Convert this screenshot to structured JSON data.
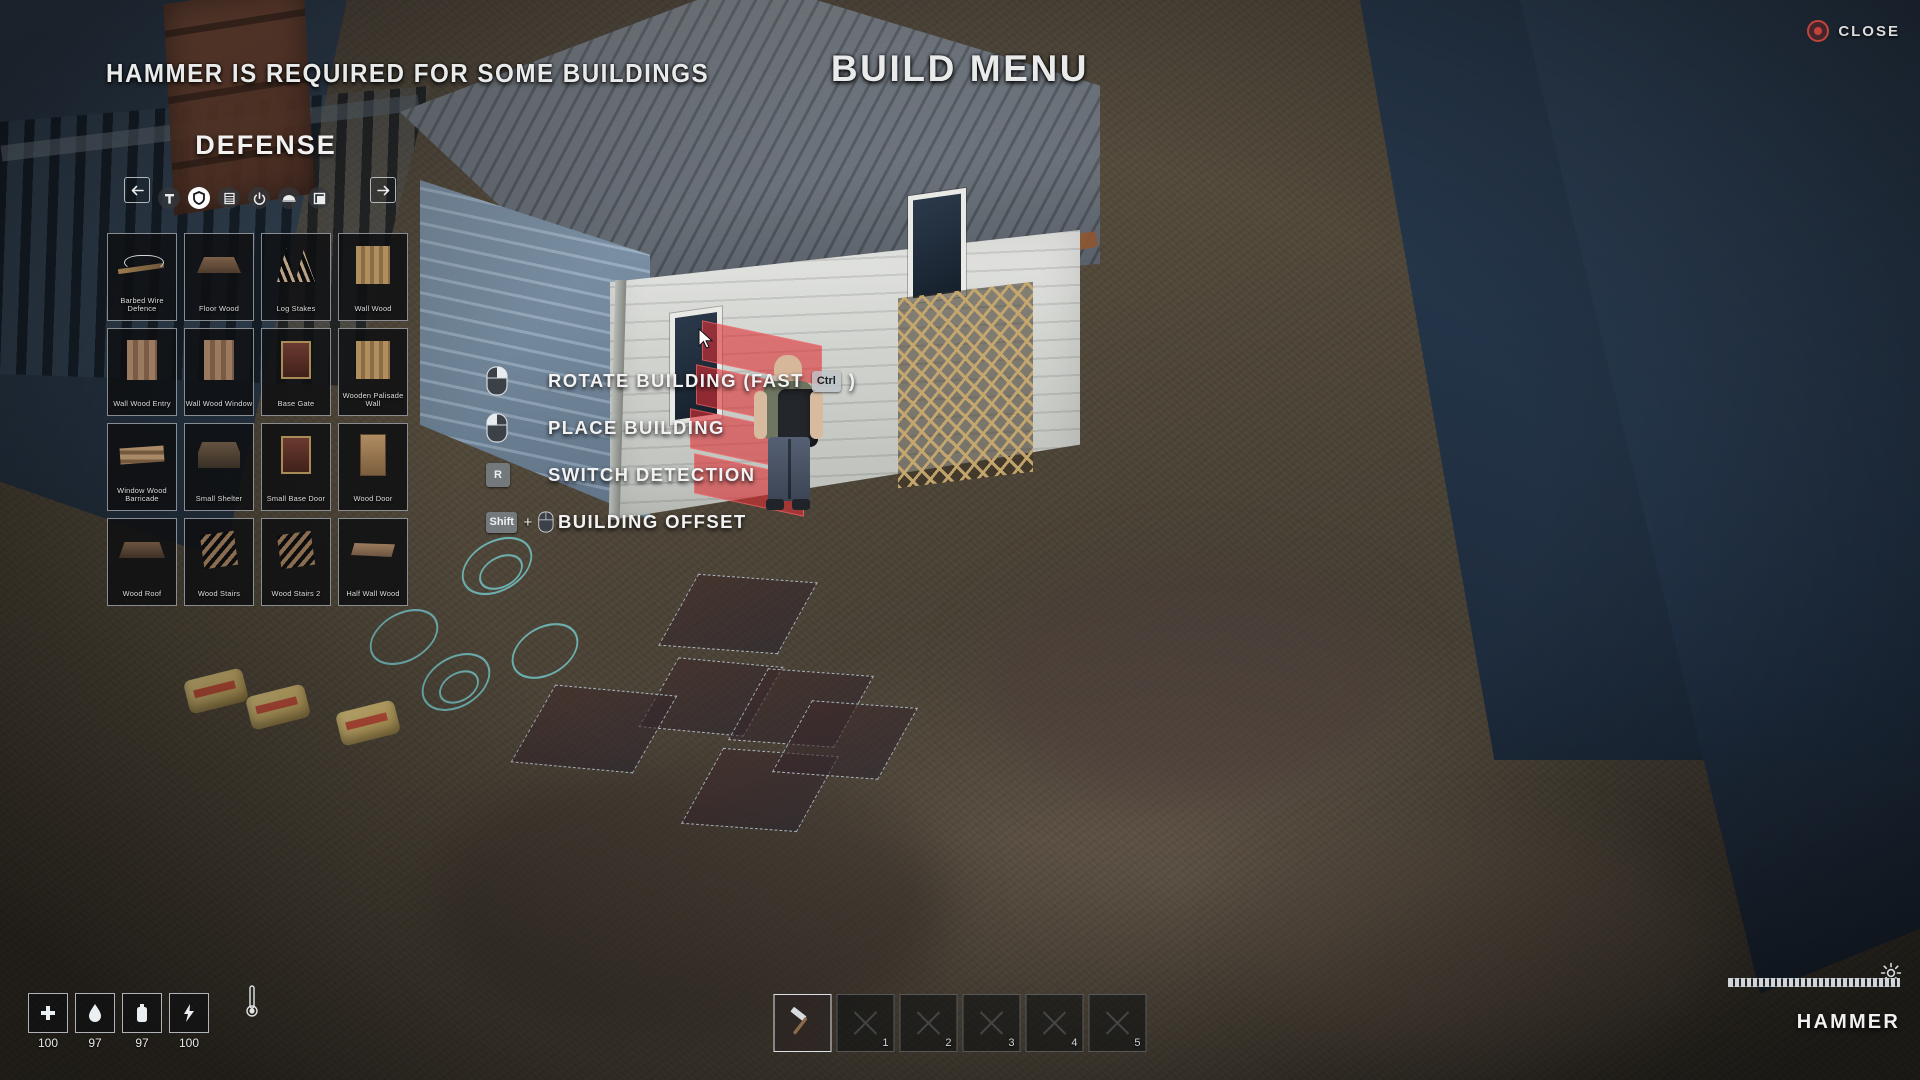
{
  "header": {
    "hint_top": "HAMMER IS REQUIRED FOR SOME BUILDINGS",
    "title": "BUILD MENU",
    "close_label": "CLOSE",
    "close_icon": "close-circle-icon"
  },
  "panel": {
    "category_title": "DEFENSE",
    "prev_arrow": "←",
    "next_arrow": "→",
    "prev_icon": "arrow-left-icon",
    "next_icon": "arrow-right-icon",
    "category_icons": [
      {
        "name": "hammer-icon",
        "label": "Tools",
        "active": false
      },
      {
        "name": "shield-icon",
        "label": "Defense",
        "active": true
      },
      {
        "name": "storage-icon",
        "label": "Storage",
        "active": false
      },
      {
        "name": "power-icon",
        "label": "Power",
        "active": false
      },
      {
        "name": "bed-icon",
        "label": "Furniture",
        "active": false
      },
      {
        "name": "panel-icon",
        "label": "Misc",
        "active": false
      }
    ],
    "items": [
      {
        "label": "Barbed Wire Defence",
        "art": "barbed"
      },
      {
        "label": "Floor Wood",
        "art": "floor"
      },
      {
        "label": "Log Stakes",
        "art": "logstakes"
      },
      {
        "label": "Wall Wood",
        "art": "fence"
      },
      {
        "label": "Wall Wood Entry",
        "art": "wall"
      },
      {
        "label": "Wall Wood Window",
        "art": "wall"
      },
      {
        "label": "Base Gate",
        "art": "darkdoor"
      },
      {
        "label": "Wooden Palisade Wall",
        "art": "fence"
      },
      {
        "label": "Window Wood Barricade",
        "art": "barricade"
      },
      {
        "label": "Small Shelter",
        "art": "shelter"
      },
      {
        "label": "Small Base Door",
        "art": "darkdoor"
      },
      {
        "label": "Wood Door",
        "art": "door"
      },
      {
        "label": "Wood Roof",
        "art": "roof"
      },
      {
        "label": "Wood Stairs",
        "art": "stairs"
      },
      {
        "label": "Wood Stairs 2",
        "art": "stairs"
      },
      {
        "label": "Half Wall Wood",
        "art": "halfwall"
      }
    ]
  },
  "hints": [
    {
      "label": "ROTATE BUILDING (FAST",
      "icon": "mouse-right-button-icon",
      "extra_key": "Ctrl",
      "suffix": ")"
    },
    {
      "label": "PLACE BUILDING",
      "icon": "mouse-left-button-icon",
      "extra_key": "",
      "suffix": ""
    },
    {
      "label": "SWITCH DETECTION",
      "icon": "key-icon",
      "key": "R",
      "extra_key": "",
      "suffix": ""
    },
    {
      "label": "BUILDING OFFSET",
      "icon": "mouse-icon",
      "key": "Shift",
      "extra_key": "",
      "suffix": ""
    }
  ],
  "status": {
    "stats": [
      {
        "icon": "health-cross-icon",
        "value": "100"
      },
      {
        "icon": "blood-drop-icon",
        "value": "97"
      },
      {
        "icon": "water-bottle-icon",
        "value": "97"
      },
      {
        "icon": "energy-bolt-icon",
        "value": "100"
      }
    ],
    "thermometer_icon": "thermometer-icon"
  },
  "hotbar": {
    "slots": [
      {
        "num": "",
        "icon": "hammer-item-icon",
        "selected": true
      },
      {
        "num": "1",
        "icon": "empty-slot-icon",
        "selected": false
      },
      {
        "num": "2",
        "icon": "empty-slot-icon",
        "selected": false
      },
      {
        "num": "3",
        "icon": "empty-slot-icon",
        "selected": false
      },
      {
        "num": "4",
        "icon": "empty-slot-icon",
        "selected": false
      },
      {
        "num": "5",
        "icon": "empty-slot-icon",
        "selected": false
      }
    ]
  },
  "equipped": {
    "item_name": "HAMMER",
    "durability_label": "",
    "gear_icon": "gear-icon"
  },
  "colors": {
    "accent_white": "#ffffff",
    "close_red": "#c0443c",
    "ghost_red": "#de2e34",
    "ui_text": "#f0f0f0"
  }
}
